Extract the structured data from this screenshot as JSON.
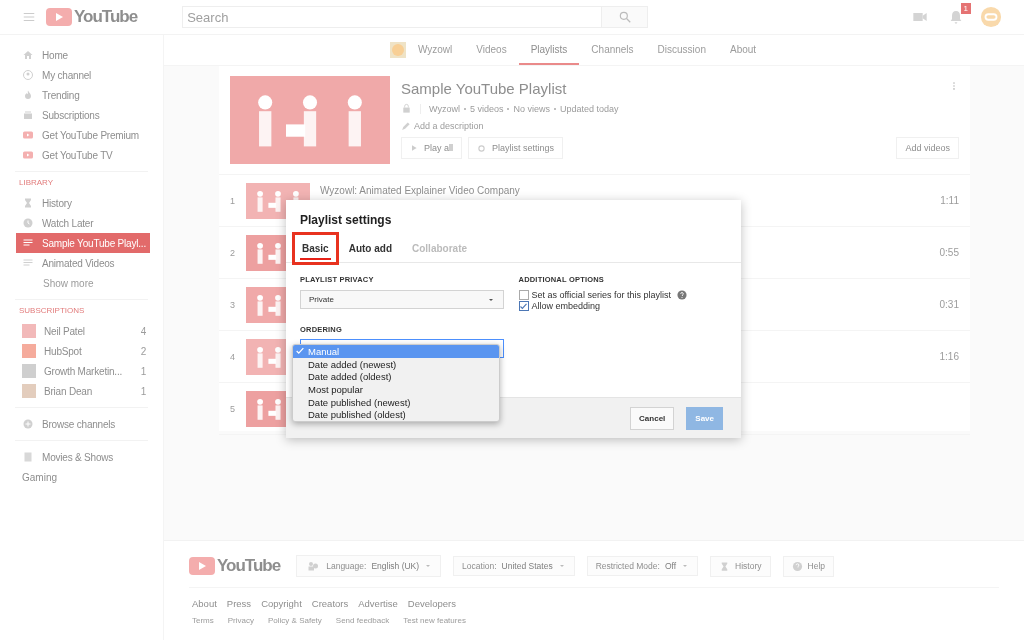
{
  "masthead": {
    "logo_text": "YouTube",
    "search": {
      "placeholder": "Search"
    },
    "notification_count": "1"
  },
  "sidebar": {
    "items": [
      {
        "label": "Home",
        "selected": false
      },
      {
        "label": "My channel",
        "selected": false
      },
      {
        "label": "Trending",
        "selected": false
      },
      {
        "label": "Subscriptions",
        "selected": false
      },
      {
        "label": "Get YouTube Premium",
        "selected": false
      },
      {
        "label": "Get YouTube TV",
        "selected": false
      }
    ],
    "library": {
      "heading": "LIBRARY",
      "items": [
        {
          "label": "History",
          "selected": false
        },
        {
          "label": "Watch Later",
          "selected": false
        },
        {
          "label": "Sample YouTube Playl...",
          "selected": true
        },
        {
          "label": "Animated Videos",
          "selected": false
        }
      ],
      "show_more": "Show more"
    },
    "subscriptions": {
      "heading": "SUBSCRIPTIONS",
      "items": [
        {
          "label": "Neil Patel",
          "count": "4"
        },
        {
          "label": "HubSpot",
          "count": "2"
        },
        {
          "label": "Growth Marketin...",
          "count": "1"
        },
        {
          "label": "Brian Dean",
          "count": "1"
        }
      ]
    },
    "browse": "Browse channels",
    "more_items": [
      "Movies & Shows",
      "Gaming"
    ]
  },
  "channel_tabs": [
    {
      "label": "Wyzowl",
      "selected": false
    },
    {
      "label": "Videos",
      "selected": false
    },
    {
      "label": "Playlists",
      "selected": true
    },
    {
      "label": "Channels",
      "selected": false
    },
    {
      "label": "Discussion",
      "selected": false
    },
    {
      "label": "About",
      "selected": false
    }
  ],
  "playlist": {
    "title": "Sample YouTube Playlist",
    "meta": [
      "Wyzowl",
      "5 videos",
      "No views",
      "Updated today"
    ],
    "description_placeholder": "Add a description",
    "buttons": [
      "Play all",
      "Playlist settings"
    ],
    "add_button": "Add videos",
    "rows": [
      {
        "index": "1",
        "title": "Wyzowl: Animated Explainer Video Company",
        "duration": "1:11"
      },
      {
        "index": "2",
        "duration": "0:55"
      },
      {
        "index": "3",
        "duration": "0:31"
      },
      {
        "index": "4",
        "duration": "1:16"
      },
      {
        "index": "5"
      }
    ]
  },
  "dialog": {
    "title": "Playlist settings",
    "tabs": [
      {
        "label": "Basic",
        "selected": true,
        "highlighted": true,
        "disabled": false
      },
      {
        "label": "Auto add",
        "selected": false,
        "highlighted": false,
        "disabled": false
      },
      {
        "label": "Collaborate",
        "selected": false,
        "highlighted": false,
        "disabled": true
      }
    ],
    "privacy": {
      "label": "PLAYLIST PRIVACY",
      "value": "Private"
    },
    "ordering": {
      "label": "ORDERING",
      "options": [
        {
          "label": "Manual",
          "selected": true
        },
        {
          "label": "Date added (newest)",
          "selected": false
        },
        {
          "label": "Date added (oldest)",
          "selected": false
        },
        {
          "label": "Most popular",
          "selected": false
        },
        {
          "label": "Date published (newest)",
          "selected": false
        },
        {
          "label": "Date published (oldest)",
          "selected": false
        }
      ]
    },
    "additional": {
      "label": "ADDITIONAL OPTIONS",
      "options": [
        {
          "label": "Set as official series for this playlist",
          "checked": false,
          "help": true
        },
        {
          "label": "Allow embedding",
          "checked": true,
          "help": false
        }
      ]
    },
    "buttons": [
      {
        "label": "Cancel",
        "disabled": false
      },
      {
        "label": "Save",
        "disabled": true
      }
    ]
  },
  "footer": {
    "logo_text": "YouTube",
    "pickers": [
      {
        "label": "Language:",
        "value": "English (UK)"
      },
      {
        "label": "Location:",
        "value": "United States"
      },
      {
        "label": "Restricted Mode:",
        "value": "Off"
      }
    ],
    "buttons": [
      "History",
      "Help"
    ],
    "links": [
      "About",
      "Press",
      "Copyright",
      "Creators",
      "Advertise",
      "Developers"
    ],
    "small_links": [
      "Terms",
      "Privacy",
      "Policy & Safety",
      "Send feedback",
      "Test new features"
    ]
  }
}
